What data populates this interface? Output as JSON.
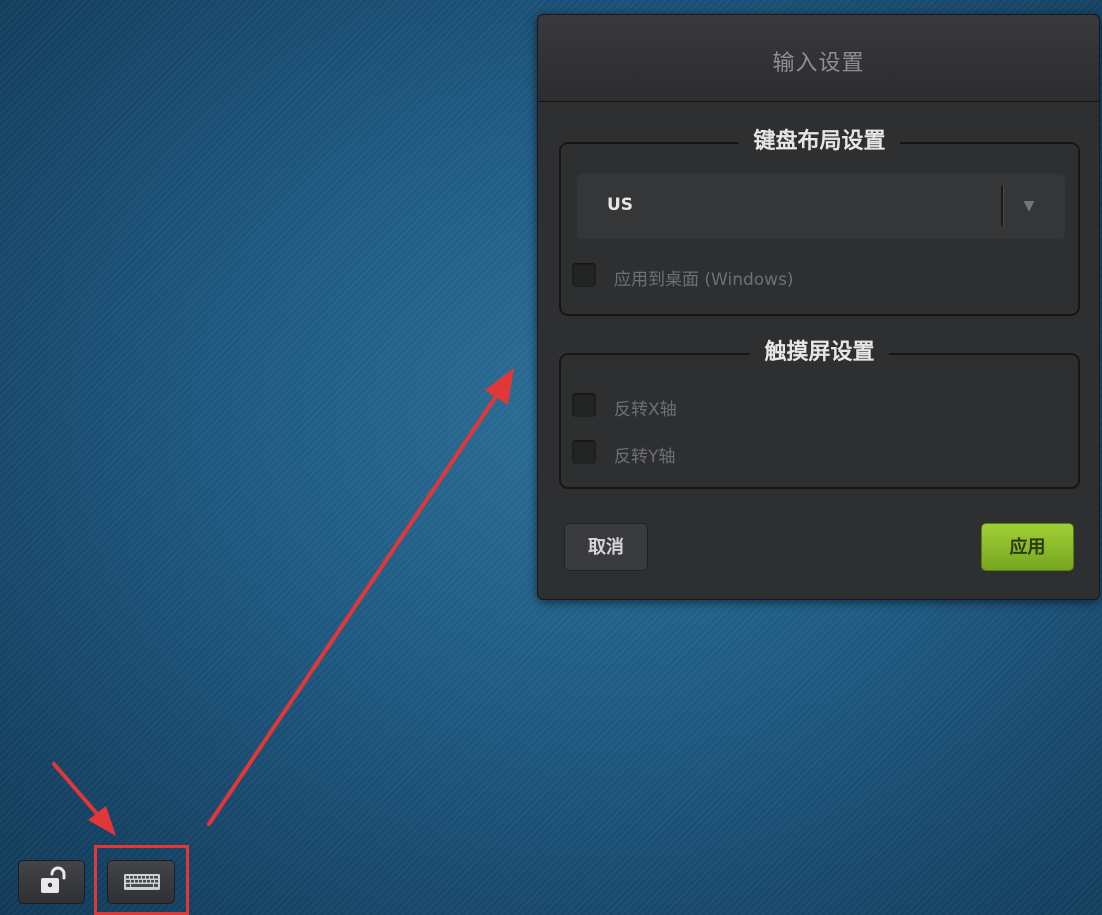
{
  "dialog": {
    "title": "输入设置",
    "keyboard_section": {
      "title": "键盘布局设置",
      "layout_select": {
        "value": "US"
      },
      "apply_desktop": {
        "label": "应用到桌面 (Windows)",
        "checked": false
      }
    },
    "touch_section": {
      "title": "触摸屏设置",
      "invert_x": {
        "label": "反转X轴",
        "checked": false
      },
      "invert_y": {
        "label": "反转Y轴",
        "checked": false
      }
    },
    "buttons": {
      "cancel": "取消",
      "apply": "应用"
    }
  },
  "taskbar": {
    "items": [
      {
        "icon": "unlock-icon"
      },
      {
        "icon": "keyboard-icon"
      }
    ]
  },
  "colors": {
    "dialog_bg": "#2e2f31",
    "apply_green": "#8cbc2a",
    "annotation_red": "#e13737",
    "desktop_blue": "#1f5b84"
  }
}
